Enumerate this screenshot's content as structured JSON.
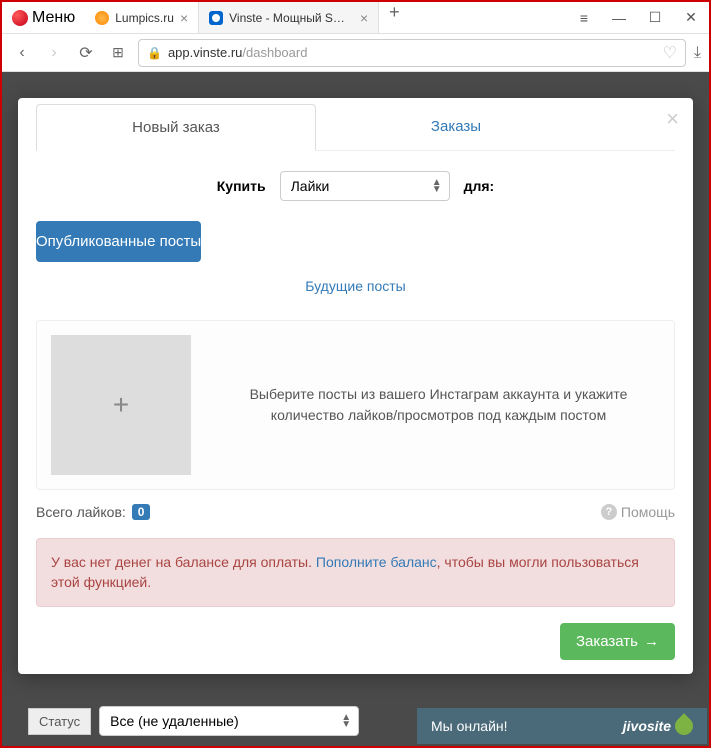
{
  "browser": {
    "menu_label": "Меню",
    "tabs": [
      {
        "title": "Lumpics.ru",
        "active": false
      },
      {
        "title": "Vinste - Мощный SMM-с",
        "active": true
      }
    ],
    "address_host": "app.vinste.ru",
    "address_path": "/dashboard"
  },
  "modal": {
    "tab_new_order": "Новый заказ",
    "tab_orders": "Заказы",
    "buy_label": "Купить",
    "select_value": "Лайки",
    "for_label": "для:",
    "published_btn": "Опубликованные посты",
    "future_link": "Будущие посты",
    "placeholder_plus": "+",
    "posts_desc": "Выберите посты из вашего Инстаграм аккаунта и укажите количество лайков/просмотров под каждым постом",
    "likes_total_label": "Всего лайков:",
    "likes_count": "0",
    "help_label": "Помощь",
    "alert_before": "У вас нет денег на балансе для оплаты. ",
    "alert_link": "Пополните баланс",
    "alert_after": ", чтобы вы могли пользоваться этой функцией.",
    "order_btn": "Заказать"
  },
  "bottom": {
    "status_label": "Статус",
    "status_value": "Все (не удаленные)"
  },
  "jivo": {
    "online_text": "Мы онлайн!",
    "brand": "jivosite"
  }
}
